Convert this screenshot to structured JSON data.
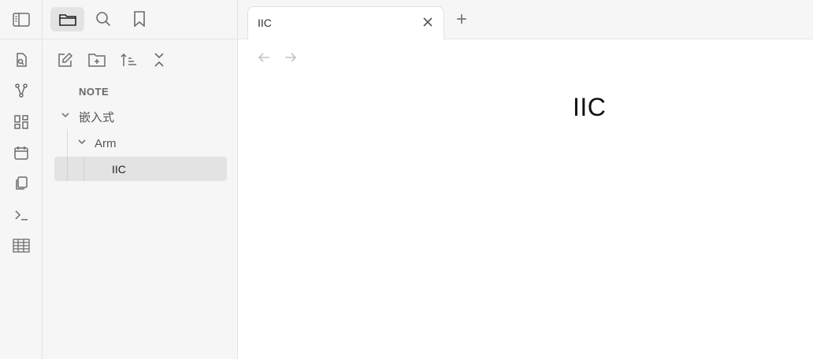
{
  "ribbon": {
    "items": [
      {
        "icon": "search-file-icon"
      },
      {
        "icon": "graph-icon"
      },
      {
        "icon": "canvas-icon"
      },
      {
        "icon": "calendar-icon"
      },
      {
        "icon": "copy-icon"
      },
      {
        "icon": "terminal-icon"
      },
      {
        "icon": "table-icon"
      }
    ]
  },
  "topbar": {
    "toggle_icon": "sidebar-toggle-icon",
    "tabs": [
      "folder-icon",
      "search-icon",
      "bookmark-icon"
    ],
    "active_tab": "folder-icon"
  },
  "explorer": {
    "actions": [
      "new-note-icon",
      "new-folder-icon",
      "sort-icon",
      "collapse-icon"
    ],
    "vault_name": "NOTE",
    "tree": [
      {
        "label": "嵌入式",
        "depth": 0,
        "expanded": true
      },
      {
        "label": "Arm",
        "depth": 1,
        "expanded": true
      },
      {
        "label": "IIC",
        "depth": 2,
        "selected": true
      }
    ]
  },
  "tabs": {
    "items": [
      {
        "title": "IIC",
        "active": true
      }
    ],
    "new_tab_symbol": "+"
  },
  "document": {
    "title": "IIC"
  },
  "colors": {
    "sidebar_bg": "#f6f6f6",
    "selected_bg": "#e3e3e3",
    "text": "#222222",
    "muted": "#6b6b6b"
  }
}
